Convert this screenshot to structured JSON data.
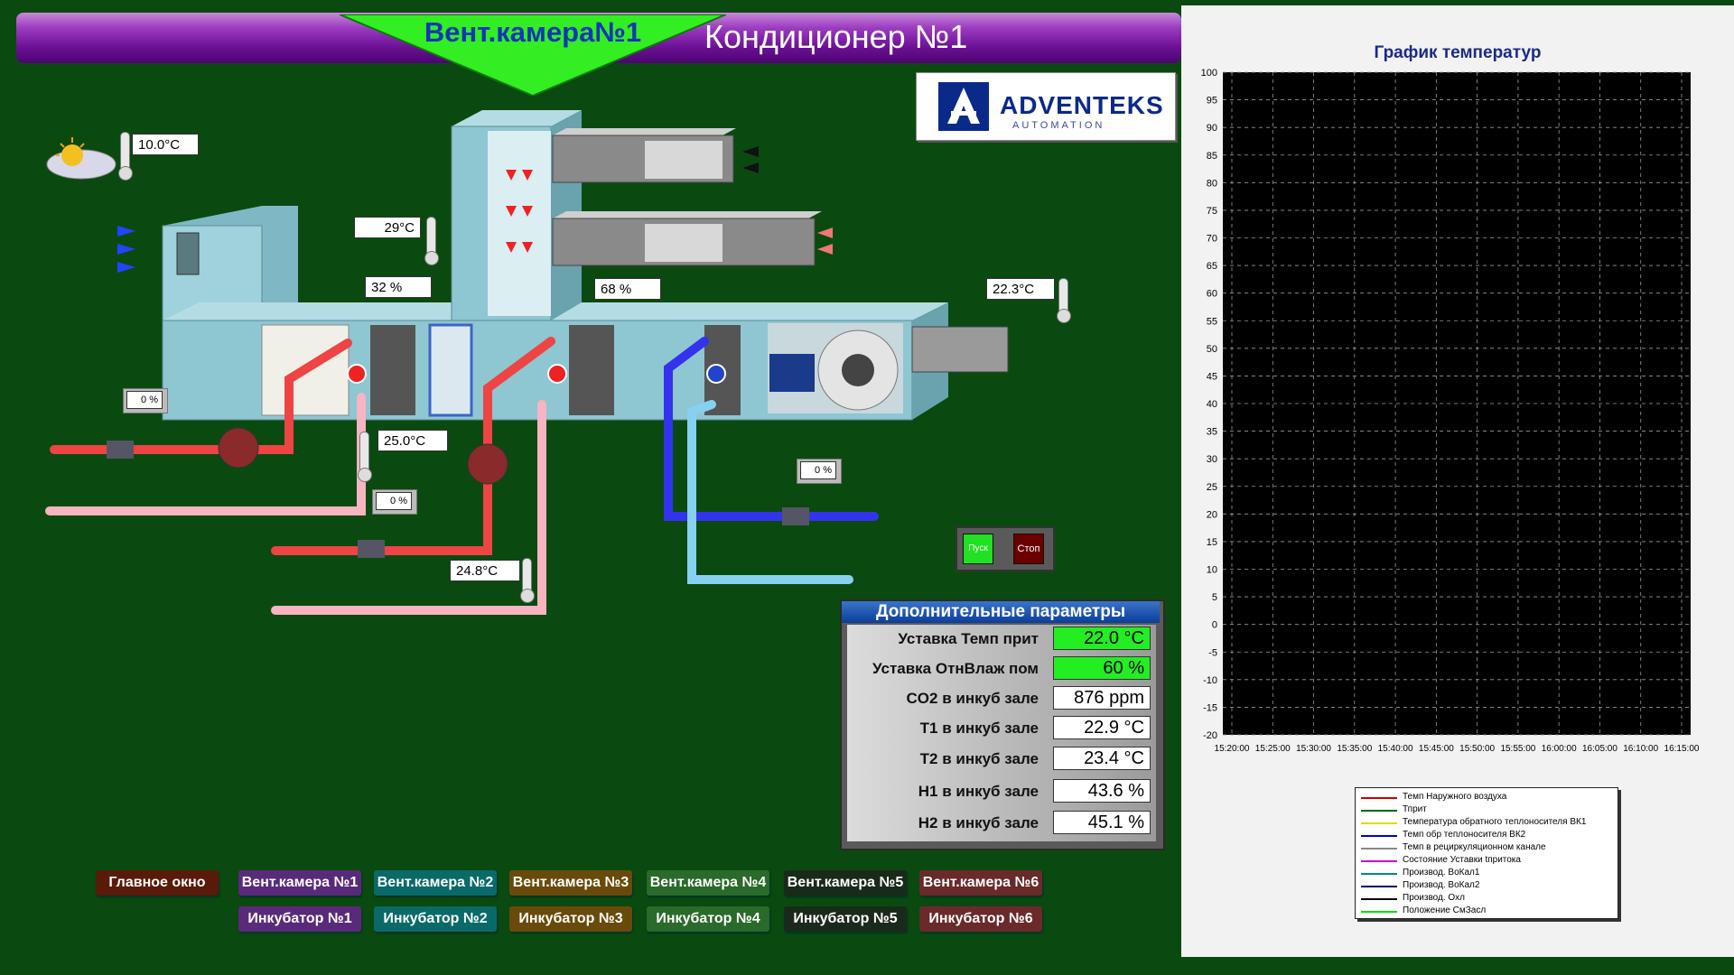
{
  "header": {
    "camera_title": "Вент.камера№1",
    "conditioner_title": "Кондиционер №1"
  },
  "logo": {
    "name": "ADVENTEKS",
    "sub": "AUTOMATION"
  },
  "readings": {
    "outdoor_temp": "10.0°C",
    "recirc_temp": "29°C",
    "damper_left": "32 %",
    "damper_right": "68 %",
    "supply_temp": "22.3°C",
    "heater1_return": "25.0°C",
    "heater2_return": "24.8°C",
    "valve1": "0 %",
    "valve2": "0 %",
    "valve3": "0 %"
  },
  "controls": {
    "start": "Пуск",
    "stop": "Стоп"
  },
  "params": {
    "title": "Дополнительные параметры",
    "rows": [
      {
        "label": "Уставка Темп прит",
        "value": "22.0  °C"
      },
      {
        "label": "Уставка ОтнВлаж пом",
        "value": "60  %"
      },
      {
        "label": "CO2 в инкуб зале",
        "value": "876 ppm"
      },
      {
        "label": "T1 в инкуб зале",
        "value": "22.9 °C"
      },
      {
        "label": "T2 в инкуб зале",
        "value": "23.4 °C"
      },
      {
        "label": "H1 в инкуб зале",
        "value": "43.6  %"
      },
      {
        "label": "H2 в инкуб зале",
        "value": "45.1  %"
      }
    ]
  },
  "nav": {
    "main": "Главное окно",
    "row1": [
      "Вент.камера №1",
      "Вент.камера №2",
      "Вент.камера №3",
      "Вент.камера №4",
      "Вент.камера №5",
      "Вент.камера №6"
    ],
    "row2": [
      "Инкубатор №1",
      "Инкубатор №2",
      "Инкубатор №3",
      "Инкубатор №4",
      "Инкубатор №5",
      "Инкубатор №6"
    ],
    "colors": [
      "#5a2a7a",
      "#0a6a6a",
      "#6a4a0a",
      "#2a6a2a",
      "#1a2a1a",
      "#6a2a2a"
    ]
  },
  "chart_data": {
    "type": "line",
    "title": "График температур",
    "ylim": [
      -20,
      100
    ],
    "yticks": [
      100,
      95,
      90,
      85,
      80,
      75,
      70,
      65,
      60,
      55,
      50,
      45,
      40,
      35,
      30,
      25,
      20,
      15,
      10,
      5,
      0,
      -5,
      -10,
      -15,
      -20
    ],
    "xticks": [
      "15:20:00",
      "15:25:00",
      "15:30:00",
      "15:35:00",
      "15:40:00",
      "15:45:00",
      "15:50:00",
      "15:55:00",
      "16:00:00",
      "16:05:00",
      "16:10:00",
      "16:15:00"
    ],
    "grid": true,
    "series": [
      {
        "name": "Темп Наружного воздуха",
        "color": "#cc0000",
        "values": []
      },
      {
        "name": "Тприт",
        "color": "#006600",
        "values": []
      },
      {
        "name": "Температура обратного теплоносителя ВК1",
        "color": "#dddd00",
        "values": []
      },
      {
        "name": "Темп обр теплоносителя ВК2",
        "color": "#0000cc",
        "values": []
      },
      {
        "name": "Темп в рециркуляционном канале",
        "color": "#888888",
        "values": []
      },
      {
        "name": "Состояние Уставки tпритока",
        "color": "#cc00cc",
        "values": []
      },
      {
        "name": "Производ. ВоКал1",
        "color": "#008888",
        "values": []
      },
      {
        "name": "Производ. ВоКал2",
        "color": "#000066",
        "values": []
      },
      {
        "name": "Производ. Охл",
        "color": "#000000",
        "values": []
      },
      {
        "name": "Положение СмЗасл",
        "color": "#00dd00",
        "values": []
      }
    ]
  }
}
